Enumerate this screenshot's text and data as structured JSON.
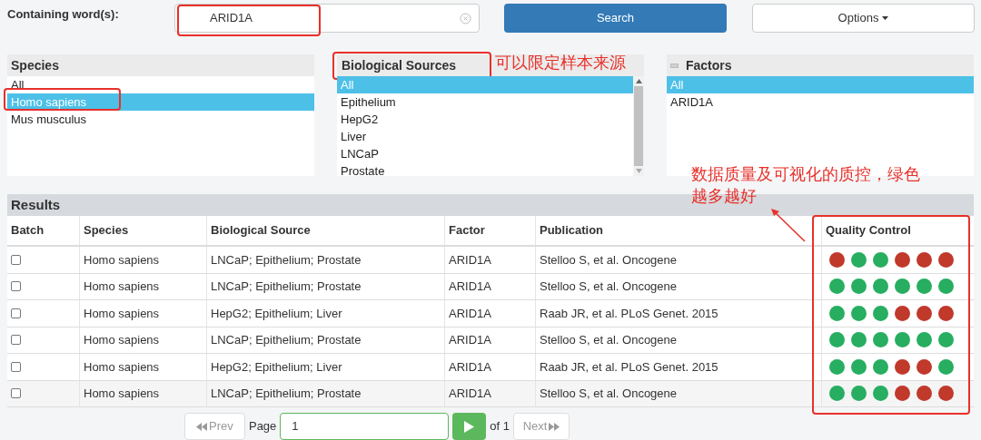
{
  "search": {
    "label": "Containing word(s):",
    "value": "ARID1A",
    "button": "Search",
    "options_button": "Options"
  },
  "filters": [
    {
      "title": "Species",
      "kind": "plain",
      "title_highlighted": false,
      "items": [
        {
          "label": "All",
          "selected": false
        },
        {
          "label": "Homo sapiens",
          "selected": true
        },
        {
          "label": "Mus musculus",
          "selected": false
        }
      ]
    },
    {
      "title": "Biological Sources",
      "kind": "scroll",
      "title_highlighted": true,
      "items": [
        {
          "label": "All",
          "selected": true
        },
        {
          "label": "Epithelium",
          "selected": false
        },
        {
          "label": "HepG2",
          "selected": false
        },
        {
          "label": "Liver",
          "selected": false
        },
        {
          "label": "LNCaP",
          "selected": false
        },
        {
          "label": "Prostate",
          "selected": false
        }
      ]
    },
    {
      "title": "Factors",
      "kind": "collapsible",
      "title_highlighted": false,
      "items": [
        {
          "label": "All",
          "selected": true
        },
        {
          "label": "ARID1A",
          "selected": false
        }
      ]
    }
  ],
  "results": {
    "title": "Results",
    "columns": [
      "Batch",
      "Species",
      "Biological Source",
      "Factor",
      "Publication",
      "Quality Control"
    ],
    "rows": [
      {
        "cells": [
          {
            "kind": "checkbox",
            "checked": false
          },
          {
            "kind": "text",
            "text": "Homo sapiens"
          },
          {
            "kind": "text",
            "text": "LNCaP; Epithelium; Prostate"
          },
          {
            "kind": "text",
            "text": "ARID1A"
          },
          {
            "kind": "text",
            "text": "Stelloo S, et al. Oncogene"
          },
          {
            "kind": "dots",
            "dots": [
              {
                "color": "#c0392b"
              },
              {
                "color": "#27ae60"
              },
              {
                "color": "#27ae60"
              },
              {
                "color": "#c0392b"
              },
              {
                "color": "#c0392b"
              },
              {
                "color": "#c0392b"
              }
            ]
          }
        ]
      },
      {
        "cells": [
          {
            "kind": "checkbox",
            "checked": false
          },
          {
            "kind": "text",
            "text": "Homo sapiens"
          },
          {
            "kind": "text",
            "text": "LNCaP; Epithelium; Prostate"
          },
          {
            "kind": "text",
            "text": "ARID1A"
          },
          {
            "kind": "text",
            "text": "Stelloo S, et al. Oncogene"
          },
          {
            "kind": "dots",
            "dots": [
              {
                "color": "#27ae60"
              },
              {
                "color": "#27ae60"
              },
              {
                "color": "#27ae60"
              },
              {
                "color": "#27ae60"
              },
              {
                "color": "#27ae60"
              },
              {
                "color": "#27ae60"
              }
            ]
          }
        ]
      },
      {
        "cells": [
          {
            "kind": "checkbox",
            "checked": false
          },
          {
            "kind": "text",
            "text": "Homo sapiens"
          },
          {
            "kind": "text",
            "text": "HepG2; Epithelium; Liver"
          },
          {
            "kind": "text",
            "text": "ARID1A"
          },
          {
            "kind": "text",
            "text": "Raab JR, et al. PLoS Genet. 2015"
          },
          {
            "kind": "dots",
            "dots": [
              {
                "color": "#27ae60"
              },
              {
                "color": "#27ae60"
              },
              {
                "color": "#27ae60"
              },
              {
                "color": "#c0392b"
              },
              {
                "color": "#c0392b"
              },
              {
                "color": "#c0392b"
              }
            ]
          }
        ]
      },
      {
        "cells": [
          {
            "kind": "checkbox",
            "checked": false
          },
          {
            "kind": "text",
            "text": "Homo sapiens"
          },
          {
            "kind": "text",
            "text": "LNCaP; Epithelium; Prostate"
          },
          {
            "kind": "text",
            "text": "ARID1A"
          },
          {
            "kind": "text",
            "text": "Stelloo S, et al. Oncogene"
          },
          {
            "kind": "dots",
            "dots": [
              {
                "color": "#27ae60"
              },
              {
                "color": "#27ae60"
              },
              {
                "color": "#27ae60"
              },
              {
                "color": "#27ae60"
              },
              {
                "color": "#27ae60"
              },
              {
                "color": "#27ae60"
              }
            ]
          }
        ]
      },
      {
        "cells": [
          {
            "kind": "checkbox",
            "checked": false
          },
          {
            "kind": "text",
            "text": "Homo sapiens"
          },
          {
            "kind": "text",
            "text": "HepG2; Epithelium; Liver"
          },
          {
            "kind": "text",
            "text": "ARID1A"
          },
          {
            "kind": "text",
            "text": "Raab JR, et al. PLoS Genet. 2015"
          },
          {
            "kind": "dots",
            "dots": [
              {
                "color": "#27ae60"
              },
              {
                "color": "#27ae60"
              },
              {
                "color": "#27ae60"
              },
              {
                "color": "#c0392b"
              },
              {
                "color": "#c0392b"
              },
              {
                "color": "#27ae60"
              }
            ]
          }
        ]
      },
      {
        "cells": [
          {
            "kind": "checkbox",
            "checked": false
          },
          {
            "kind": "text",
            "text": "Homo sapiens"
          },
          {
            "kind": "text",
            "text": "LNCaP; Epithelium; Prostate"
          },
          {
            "kind": "text",
            "text": "ARID1A"
          },
          {
            "kind": "text",
            "text": "Stelloo S, et al. Oncogene"
          },
          {
            "kind": "dots",
            "dots": [
              {
                "color": "#27ae60"
              },
              {
                "color": "#27ae60"
              },
              {
                "color": "#27ae60"
              },
              {
                "color": "#c0392b"
              },
              {
                "color": "#c0392b"
              },
              {
                "color": "#c0392b"
              }
            ]
          }
        ]
      }
    ]
  },
  "pagination": {
    "prev": "Prev",
    "page_label": "Page",
    "page": "1",
    "of": "of 1",
    "next": "Next"
  },
  "annotations": [
    {
      "text": "可以限定样本来源"
    },
    {
      "text": "数据质量及可视化的质控，绿色越多越好"
    }
  ]
}
